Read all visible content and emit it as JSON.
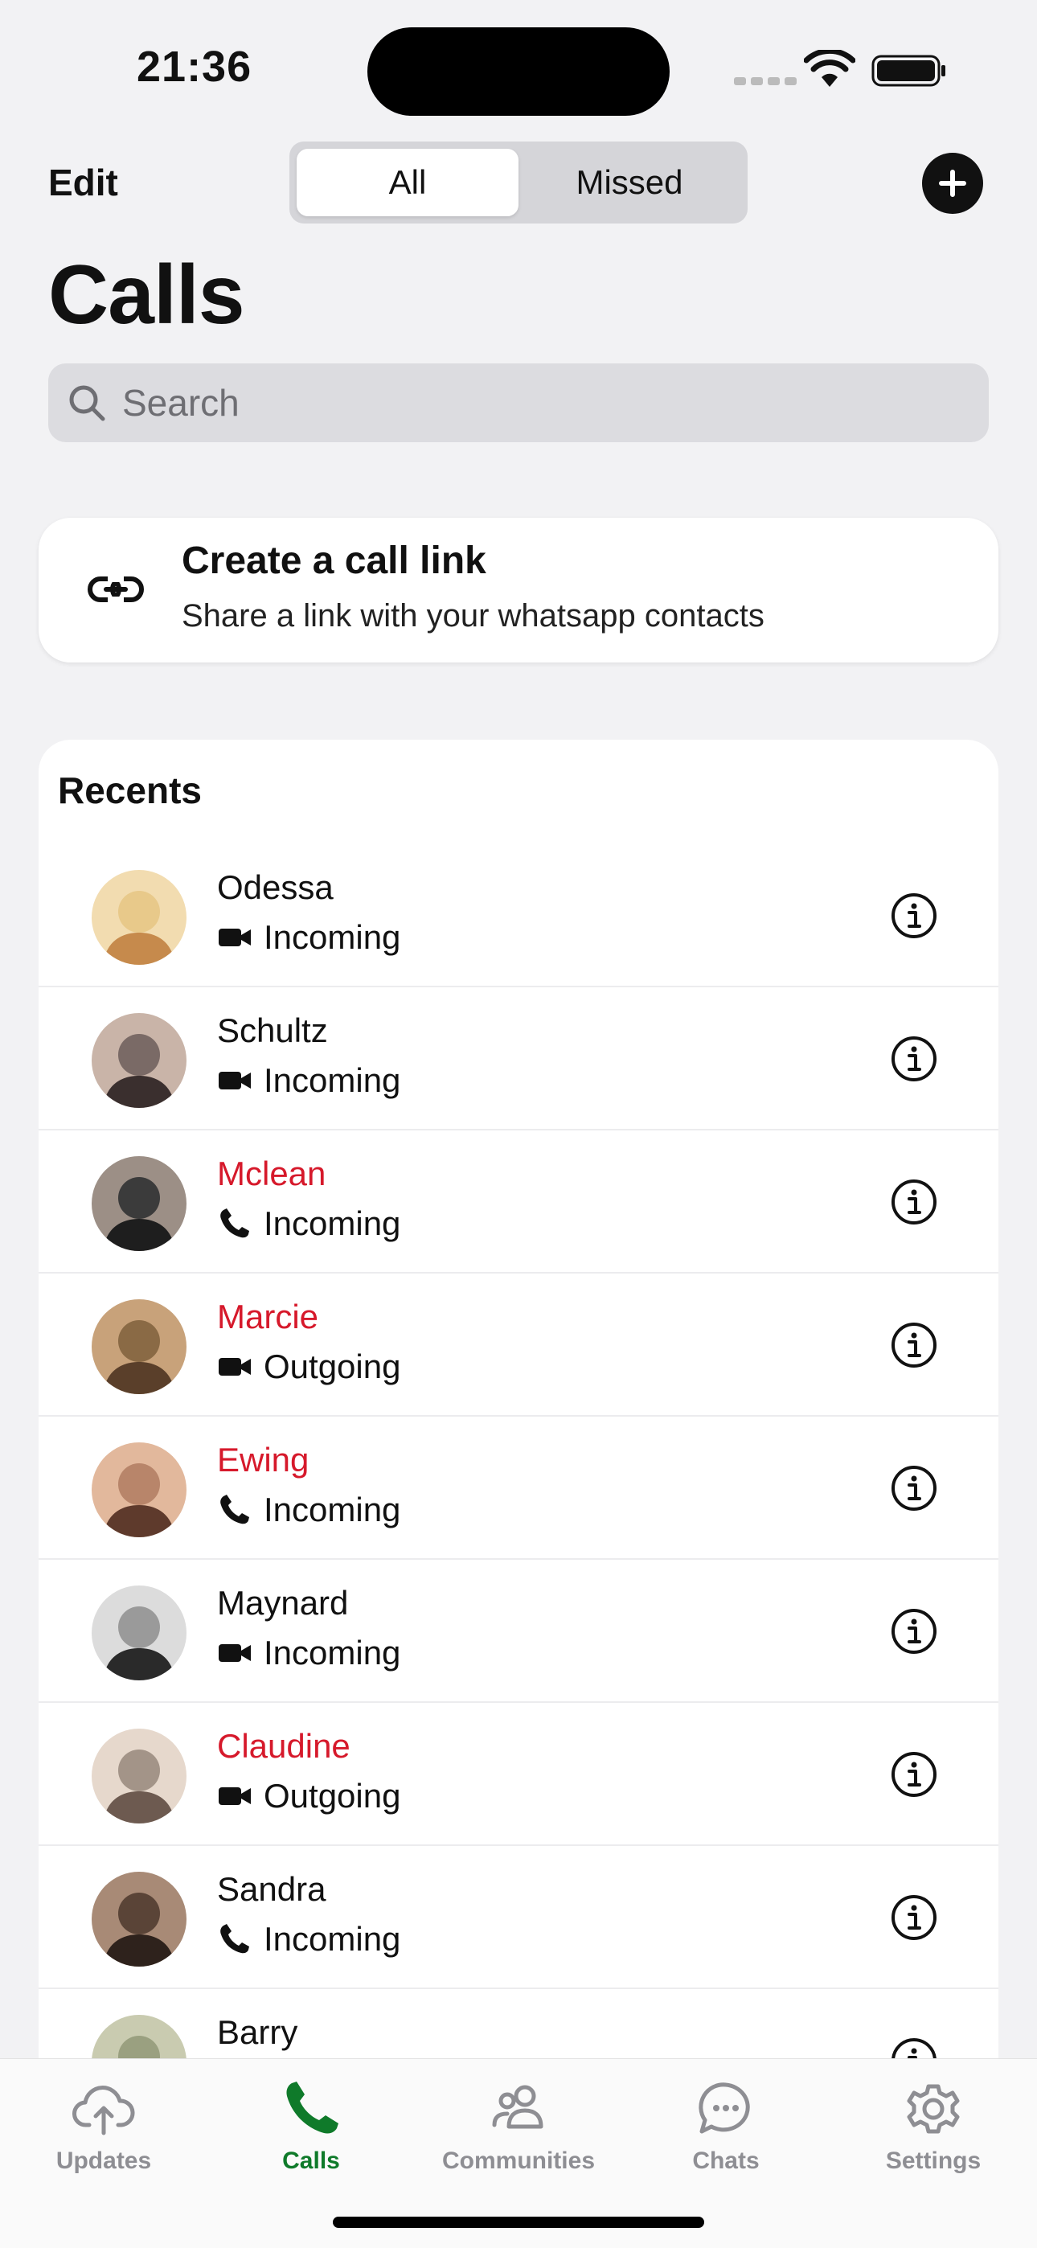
{
  "status_bar": {
    "time": "21:36"
  },
  "header": {
    "edit_label": "Edit",
    "segments": [
      "All",
      "Missed"
    ],
    "active_segment": "All",
    "title": "Calls"
  },
  "search": {
    "placeholder": "Search"
  },
  "call_link": {
    "title": "Create a call link",
    "subtitle": "Share a link with your whatsapp contacts"
  },
  "recents": {
    "title": "Recents",
    "items": [
      {
        "name": "Odessa",
        "call_type": "Incoming",
        "media": "video",
        "missed": false
      },
      {
        "name": "Schultz",
        "call_type": "Incoming",
        "media": "video",
        "missed": false
      },
      {
        "name": "Mclean",
        "call_type": "Incoming",
        "media": "voice",
        "missed": true
      },
      {
        "name": "Marcie",
        "call_type": "Outgoing",
        "media": "video",
        "missed": true
      },
      {
        "name": "Ewing",
        "call_type": "Incoming",
        "media": "voice",
        "missed": true
      },
      {
        "name": "Maynard",
        "call_type": "Incoming",
        "media": "video",
        "missed": false
      },
      {
        "name": "Claudine",
        "call_type": "Outgoing",
        "media": "video",
        "missed": true
      },
      {
        "name": "Sandra",
        "call_type": "Incoming",
        "media": "voice",
        "missed": false
      },
      {
        "name": "Barry",
        "call_type": "",
        "media": "",
        "missed": false
      }
    ]
  },
  "tabs": [
    {
      "label": "Updates",
      "icon": "upload-cloud-icon",
      "active": false
    },
    {
      "label": "Calls",
      "icon": "phone-icon",
      "active": true
    },
    {
      "label": "Communities",
      "icon": "communities-icon",
      "active": false
    },
    {
      "label": "Chats",
      "icon": "chat-bubble-icon",
      "active": false
    },
    {
      "label": "Settings",
      "icon": "gear-icon",
      "active": false
    }
  ],
  "colors": {
    "background": "#f2f2f4",
    "missed_red": "#d6192b",
    "active_green": "#0f7a2a",
    "inactive_gray": "#8e8e93"
  }
}
